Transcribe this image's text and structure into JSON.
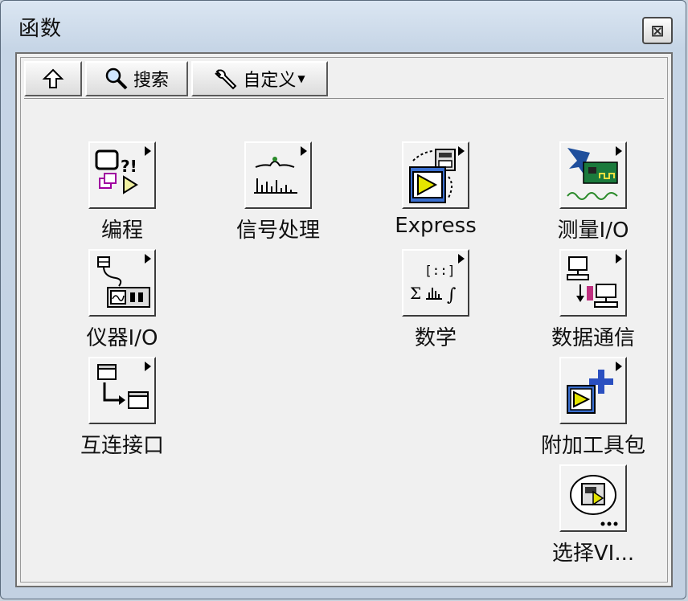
{
  "window": {
    "title": "函数"
  },
  "toolbar": {
    "up_label": "",
    "search_label": "搜索",
    "custom_label": "自定义"
  },
  "palette": {
    "programming": "编程",
    "signal_processing": "信号处理",
    "express": "Express",
    "measurement_io": "测量I/O",
    "instrument_io": "仪器I/O",
    "mathematics": "数学",
    "data_communication": "数据通信",
    "connectivity": "互连接口",
    "addons": "附加工具包",
    "select_vi": "选择VI..."
  },
  "icons": {
    "programming": "programming-icon",
    "signal_processing": "signal-processing-icon",
    "express": "express-icon",
    "measurement_io": "measurement-io-icon",
    "instrument_io": "instrument-io-icon",
    "mathematics": "mathematics-icon",
    "data_communication": "data-communication-icon",
    "connectivity": "connectivity-icon",
    "addons": "addons-icon",
    "select_vi": "select-vi-icon"
  }
}
